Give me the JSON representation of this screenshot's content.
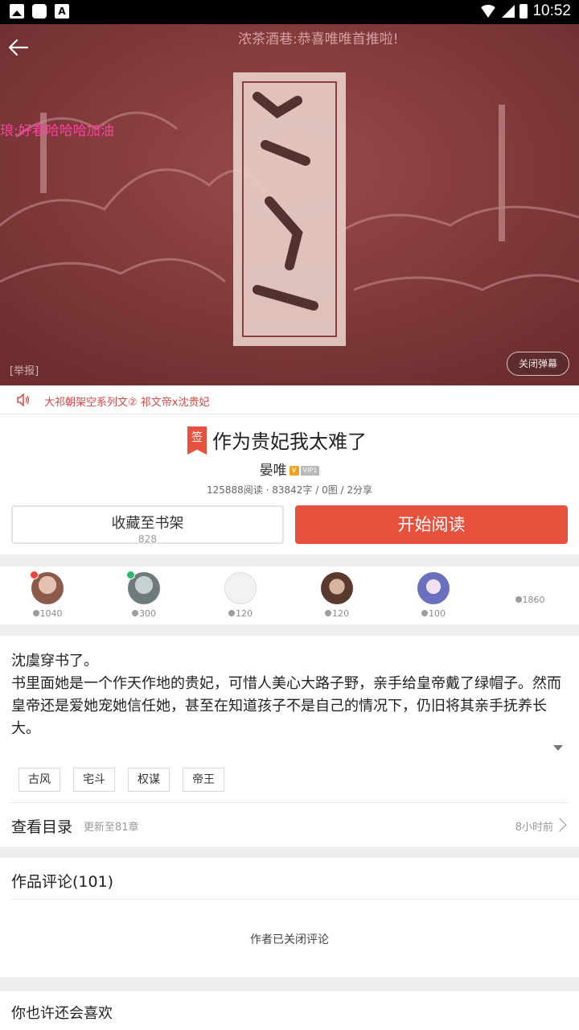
{
  "status_bar": {
    "time": "10:52"
  },
  "cover": {
    "danmaku": [
      "浓茶酒巷:恭喜唯唯首推啦!",
      "琅:好看哈哈哈加油"
    ],
    "report_label": "[举报]",
    "close_danmaku_label": "关闭弹幕"
  },
  "notice": {
    "text": "大祁朝架空系列文② 祁文帝x沈贵妃"
  },
  "book": {
    "sign_label": "签",
    "title": "作为贵妃我太难了",
    "author": "晏唯",
    "author_badge": "V",
    "vip_label": "VIP1",
    "stats": "125888阅读 · 83842字 / 0图 / 2分享",
    "shelf_label": "收藏至书架",
    "shelf_count": "828",
    "read_label": "开始阅读"
  },
  "fans": [
    {
      "coins": "1040",
      "badge_color": "#f0413d",
      "avatar_color": "#8b5a4a"
    },
    {
      "coins": "300",
      "badge_color": "#2db76b",
      "avatar_color": "#6f7a7c"
    },
    {
      "coins": "120",
      "badge_color": "",
      "avatar_color": "#eeeeee"
    },
    {
      "coins": "120",
      "badge_color": "",
      "avatar_color": "#5a3a2e"
    },
    {
      "coins": "100",
      "badge_color": "",
      "avatar_color": "#6a6fbe"
    },
    {
      "coins": "1860"
    }
  ],
  "description": {
    "lines": [
      "沈虞穿书了。",
      "书里面她是一个作天作地的贵妃，可惜人美心大路子野，亲手给皇帝戴了绿帽子。然而皇帝还是爱她宠她信任她，甚至在知道孩子不是自己的情况下，仍旧将其亲手抚养长大。"
    ],
    "tags": [
      "古风",
      "宅斗",
      "权谋",
      "帝王"
    ]
  },
  "catalog": {
    "title": "查看目录",
    "update": "更新至81章",
    "time": "8小时前"
  },
  "comments": {
    "title": "作品评论(101)",
    "closed_text": "作者已关闭评论"
  },
  "recommend": {
    "title": "你也许还会喜欢"
  }
}
